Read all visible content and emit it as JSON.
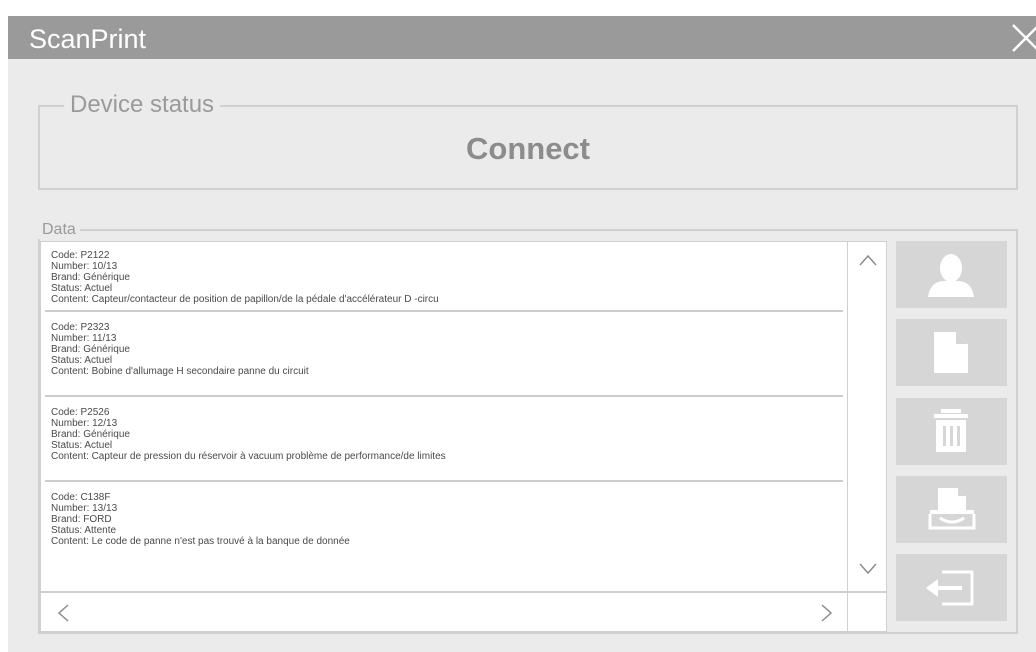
{
  "app": {
    "title": "ScanPrint"
  },
  "device_status": {
    "label": "Device status",
    "state": "Connect"
  },
  "data_panel": {
    "label": "Data",
    "entries": [
      {
        "code": "Code: P2122",
        "number": "Number: 10/13",
        "brand": "Brand: Générique",
        "status": "Status: Actuel",
        "content": "Content: Capteur/contacteur de position de papillon/de la pédale d'accélérateur D -circu"
      },
      {
        "code": "Code: P2323",
        "number": "Number: 11/13",
        "brand": "Brand: Générique",
        "status": "Status: Actuel",
        "content": "Content: Bobine d'allumage H secondaire panne du circuit"
      },
      {
        "code": "Code: P2526",
        "number": "Number: 12/13",
        "brand": "Brand: Générique",
        "status": "Status: Actuel",
        "content": "Content: Capteur de pression du réservoir à vacuum problème de performance/de limites"
      },
      {
        "code": "Code: C138F",
        "number": "Number: 13/13",
        "brand": "Brand: FORD",
        "status": "Status: Attente",
        "content": "Content: Le code de panne n'est pas trouvé à la banque de donnée"
      }
    ]
  },
  "side_buttons": [
    {
      "icon": "user-icon"
    },
    {
      "icon": "document-icon"
    },
    {
      "icon": "trash-icon"
    },
    {
      "icon": "printer-icon"
    },
    {
      "icon": "exit-icon"
    }
  ],
  "colors": {
    "titlebar": "#9a9a9a",
    "background": "#ebebeb",
    "button": "#d6d6d6",
    "text_muted": "#9a9a9a"
  }
}
